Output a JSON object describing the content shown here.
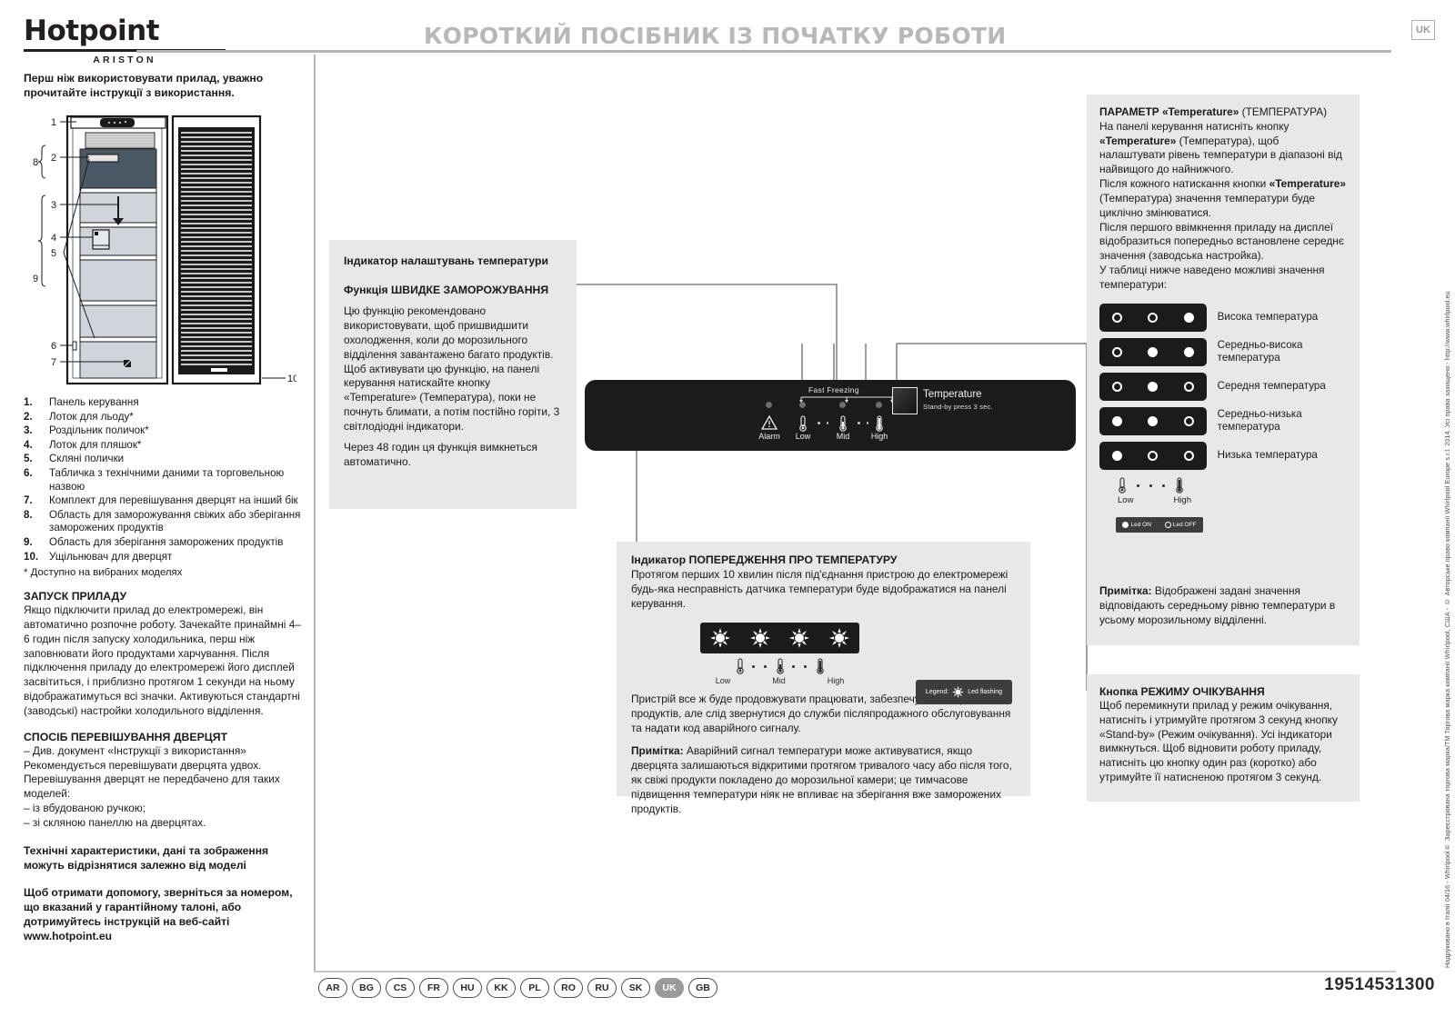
{
  "header": {
    "brand": "Hotpoint",
    "brand_sub": "ARISTON",
    "title": "КОРОТКИЙ ПОСІБНИК ІЗ ПОЧАТКУ РОБОТИ",
    "lang_badge": "UK"
  },
  "intro": "Перш ніж використовувати прилад, уважно прочитайте інструкції з використання.",
  "parts": [
    {
      "num": "1.",
      "label": "Панель керування"
    },
    {
      "num": "2.",
      "label": "Лоток для льоду*"
    },
    {
      "num": "3.",
      "label": "Роздільник поличок*"
    },
    {
      "num": "4.",
      "label": "Лоток для пляшок*"
    },
    {
      "num": "5.",
      "label": "Скляні полички"
    },
    {
      "num": "6.",
      "label": "Табличка з технічними даними та торговельною назвою"
    },
    {
      "num": "7.",
      "label": "Комплект для перевішування дверцят на інший бік"
    },
    {
      "num": "8.",
      "label": "Область для заморожування свіжих або зберігання заморожених продуктів"
    },
    {
      "num": "9.",
      "label": "Область для зберігання заморожених продуктів"
    },
    {
      "num": "10.",
      "label": "Ущільнювач для дверцят"
    }
  ],
  "parts_footnote": "* Доступно на вибраних моделях",
  "startup": {
    "heading": "ЗАПУСК ПРИЛАДУ",
    "body": "Якщо підключити прилад до електромережі, він автоматично розпочне роботу. Зачекайте принаймні 4–6 годин після запуску холодильника, перш ніж заповнювати його продуктами харчування. Після підключення приладу до електромережі його дисплей засвітиться, і приблизно протягом 1 секунди на ньому відображатимуться всі значки. Активуються стандартні (заводські) настройки холодильного відділення."
  },
  "door_reversal": {
    "heading": "СПОСІБ ПЕРЕВІШУВАННЯ ДВЕРЦЯТ",
    "body": "– Див. документ «Інструкції з використання» Рекомендується перевішувати дверцята удвох. Перевішування дверцят не передбачено для таких моделей:\n– із вбудованою ручкою;\n– зі скляною панеллю на дверцятах."
  },
  "disclaimer": "Технічні характеристики, дані та зображення можуть відрізнятися залежно від моделі",
  "help": "Щоб отримати допомогу, зверніться за номером, що вказаний у гарантійному талоні, або дотримуйтесь інструкцій на веб-сайті www.hotpoint.eu",
  "temp_setting_box": {
    "title": "Індикатор налаштувань температури",
    "subtitle": "Функція ШВИДКЕ ЗАМОРОЖУВАННЯ",
    "body": "Цю функцію рекомендовано використовувати, щоб пришвидшити охолодження, коли до морозильного відділення завантажено багато продуктів. Щоб активувати цю функцію, на панелі керування натискайте кнопку «Temperature» (Температура), поки не почнуть блимати, а потім постійно горіти, 3 світлодіодні індикатори.",
    "body2": "Через 48 годин ця функція вимкнеться автоматично."
  },
  "control_panel": {
    "fast_freezing": "Fast Freezing",
    "alarm_label": "Alarm",
    "low_label": "Low",
    "mid_label": "Mid",
    "high_label": "High",
    "button_title": "Temperature",
    "button_sub": "Stand-by  press 3 sec."
  },
  "warning_box": {
    "title": "Індикатор ПОПЕРЕДЖЕННЯ ПРО ТЕМПЕРАТУРУ",
    "body": "Протягом перших 10 хвилин після під'єднання пристрою до електромережі будь-яка несправність датчика температури буде відображатися на панелі керування.",
    "legend": "Legend:",
    "legend_value": "Led flashing",
    "low_label": "Low",
    "mid_label": "Mid",
    "high_label": "High",
    "body2": "Пристрій все ж буде продовжувати працювати, забезпечуючи зберігання продуктів, але слід звернутися до служби післяпродажного обслуговування та надати код аварійного сигналу.",
    "note_label": "Примітка:",
    "note_text": " Аварійний сигнал температури може активуватися, якщо дверцята залишаються відкритими протягом тривалого часу або після того, як свіжі продукти покладено до морозильної камери; це тимчасове підвищення температури ніяк не впливає на зберігання вже заморожених продуктів."
  },
  "right_box": {
    "head_bold": "ПАРАМЕТР «Temperature»",
    "head_rest": " (ТЕМПЕРАТУРА)",
    "p1_a": "На панелі керування натисніть кнопку ",
    "p1_b": "«Temperature»",
    "p1_c": " (Температура), щоб налаштувати рівень температури в діапазоні від найвищого до найнижчого.",
    "p2_a": "Після кожного натискання кнопки ",
    "p2_b": "«Temperature»",
    "p2_c": " (Температура) значення температури буде циклічно змінюватися.",
    "p3": "Після першого ввімкнення приладу на дисплеї відобразиться попередньо встановлене середнє значення (заводська настройка).",
    "p4": "У таблиці нижче наведено можливі значення температури:"
  },
  "temp_table": [
    {
      "leds": [
        "off",
        "off",
        "on"
      ],
      "label": "Висока температура"
    },
    {
      "leds": [
        "off",
        "on",
        "on"
      ],
      "label": "Середньо-висока температура"
    },
    {
      "leds": [
        "off",
        "on",
        "off"
      ],
      "label": "Середня температура"
    },
    {
      "leds": [
        "on",
        "on",
        "off"
      ],
      "label": "Середньо-низька температура"
    },
    {
      "leds": [
        "on",
        "off",
        "off"
      ],
      "label": "Низька температура"
    }
  ],
  "temp_scale": {
    "low": "Low",
    "high": "High"
  },
  "led_legend": {
    "on": "Led ON",
    "off": "Led OFF"
  },
  "note_box": {
    "label": "Примітка:",
    "text": " Відображені задані значення відповідають середньому рівню температури в усьому морозильному відділенні."
  },
  "standby_box": {
    "heading": "Кнопка РЕЖИМУ ОЧІКУВАННЯ",
    "body": "Щоб перемикнути прилад у режим очікування, натисніть і утримуйте протягом 3 секунд кнопку «Stand-by» (Режим очікування). Усі індикатори вимкнуться. Щоб відновити роботу приладу, натисніть цю кнопку один раз (коротко) або утримуйте її натисненою протягом 3 секунд."
  },
  "vertical_copyright": "Надруковано в Італії  04/16 - Whirlpool® Зареєстрована торгова марка/ТМ Торгова марка компанії Whirlpool, США - © Авторське право компанії Whirlpool Europe s.r.l. 2014. Усі права захищено - http://www.whirlpool.eu",
  "footer": {
    "languages": [
      "AR",
      "BG",
      "CS",
      "FR",
      "HU",
      "KK",
      "PL",
      "RO",
      "RU",
      "SK",
      "UK",
      "GB"
    ],
    "active_language": "UK",
    "doc_number": "19514531300"
  }
}
